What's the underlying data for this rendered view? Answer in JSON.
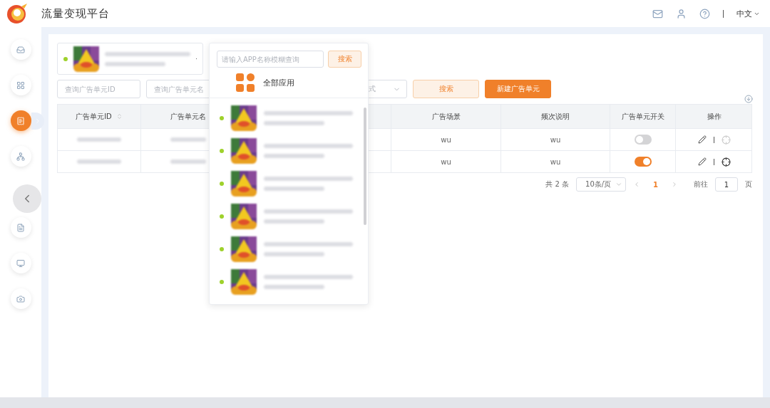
{
  "header": {
    "title": "流量变现平台",
    "language": "中文"
  },
  "sidebar": {
    "top_items": [
      {
        "kind": "inbox",
        "selected": false
      },
      {
        "kind": "grid",
        "selected": false
      },
      {
        "kind": "receipt",
        "selected": true
      },
      {
        "kind": "network",
        "selected": false
      }
    ],
    "bottom_items": [
      {
        "kind": "file",
        "selected": false
      },
      {
        "kind": "monitor",
        "selected": false
      },
      {
        "kind": "camera",
        "selected": false
      }
    ]
  },
  "filters": {
    "id_placeholder": "查询广告单元ID",
    "name_placeholder": "查询广告单元名",
    "select_placeholder": "式",
    "search_button": "搜索",
    "create_button": "新建广告单元"
  },
  "table": {
    "columns": [
      "广告单元ID",
      "广告单元名",
      "广告场景",
      "频次说明",
      "广告单元开关",
      "操作"
    ],
    "rows": [
      {
        "scene": "wu",
        "frequency": "wu",
        "on": false,
        "locate_enabled": false
      },
      {
        "scene": "wu",
        "frequency": "wu",
        "on": true,
        "locate_enabled": true
      }
    ]
  },
  "pagination": {
    "total": "共 2 条",
    "page_size": "10条/页",
    "pages": [
      {
        "label": "1",
        "selected": true
      }
    ],
    "goto_label": "前往",
    "goto_value": "1",
    "goto_suffix": "页"
  },
  "app_dropdown": {
    "search_placeholder": "请输入APP名称模糊查询",
    "search_button": "搜索",
    "all_apps": "全部应用",
    "apps": [
      {
        "kind": "app"
      },
      {
        "kind": "app"
      },
      {
        "kind": "app"
      },
      {
        "kind": "app"
      },
      {
        "kind": "app"
      },
      {
        "kind": "app"
      }
    ]
  }
}
